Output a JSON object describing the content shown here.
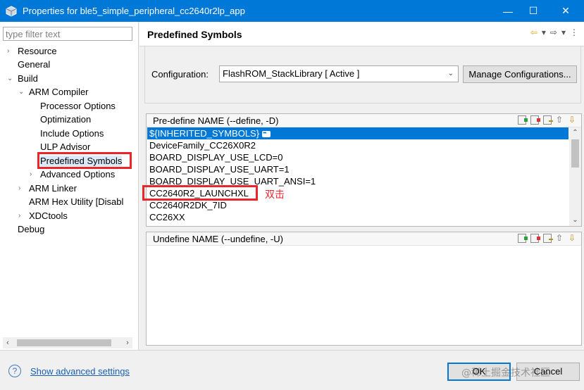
{
  "window": {
    "title": "Properties for ble5_simple_peripheral_cc2640r2lp_app",
    "minimize_icon": "minimize-icon",
    "maximize_icon": "maximize-icon",
    "close_icon": "close-icon"
  },
  "filter": {
    "placeholder": "type filter text",
    "value": ""
  },
  "tree": {
    "items": [
      {
        "label": "Resource",
        "twisty": "›"
      },
      {
        "label": "General",
        "twisty": ""
      },
      {
        "label": "Build",
        "twisty": "⌄"
      },
      {
        "label": "ARM Compiler",
        "twisty": "⌄"
      },
      {
        "label": "Processor Options",
        "twisty": ""
      },
      {
        "label": "Optimization",
        "twisty": ""
      },
      {
        "label": "Include Options",
        "twisty": ""
      },
      {
        "label": "ULP Advisor",
        "twisty": ""
      },
      {
        "label": "Predefined Symbols",
        "twisty": ""
      },
      {
        "label": "Advanced Options",
        "twisty": "›"
      },
      {
        "label": "ARM Linker",
        "twisty": "›"
      },
      {
        "label": "ARM Hex Utility  [Disabl",
        "twisty": ""
      },
      {
        "label": "XDCtools",
        "twisty": "›"
      },
      {
        "label": "Debug",
        "twisty": ""
      }
    ]
  },
  "page": {
    "title": "Predefined Symbols",
    "configuration_label": "Configuration:",
    "configuration_value": "FlashROM_StackLibrary  [ Active ]",
    "manage_button": "Manage Configurations..."
  },
  "define_group": {
    "title": "Pre-define NAME (--define, -D)",
    "rows": [
      "${INHERITED_SYMBOLS}",
      "DeviceFamily_CC26X0R2",
      "BOARD_DISPLAY_USE_LCD=0",
      "BOARD_DISPLAY_USE_UART=1",
      "BOARD_DISPLAY_USE_UART_ANSI=1",
      "CC2640R2_LAUNCHXL",
      "CC2640R2DK_7ID",
      "CC26XX"
    ]
  },
  "undefine_group": {
    "title": "Undefine NAME (--undefine, -U)",
    "rows": []
  },
  "annotation": {
    "text": "双击",
    "color": "#e8262b"
  },
  "footer": {
    "help_icon": "question-icon",
    "advanced_link": "Show advanced settings",
    "ok": "OK",
    "cancel": "Cancel",
    "watermark": "@稀土掘金技术社区"
  },
  "colors": {
    "titlebar": "#0078d7",
    "selection": "#0078d7",
    "highlight_red": "#e8262b",
    "link": "#1a5fb4"
  }
}
